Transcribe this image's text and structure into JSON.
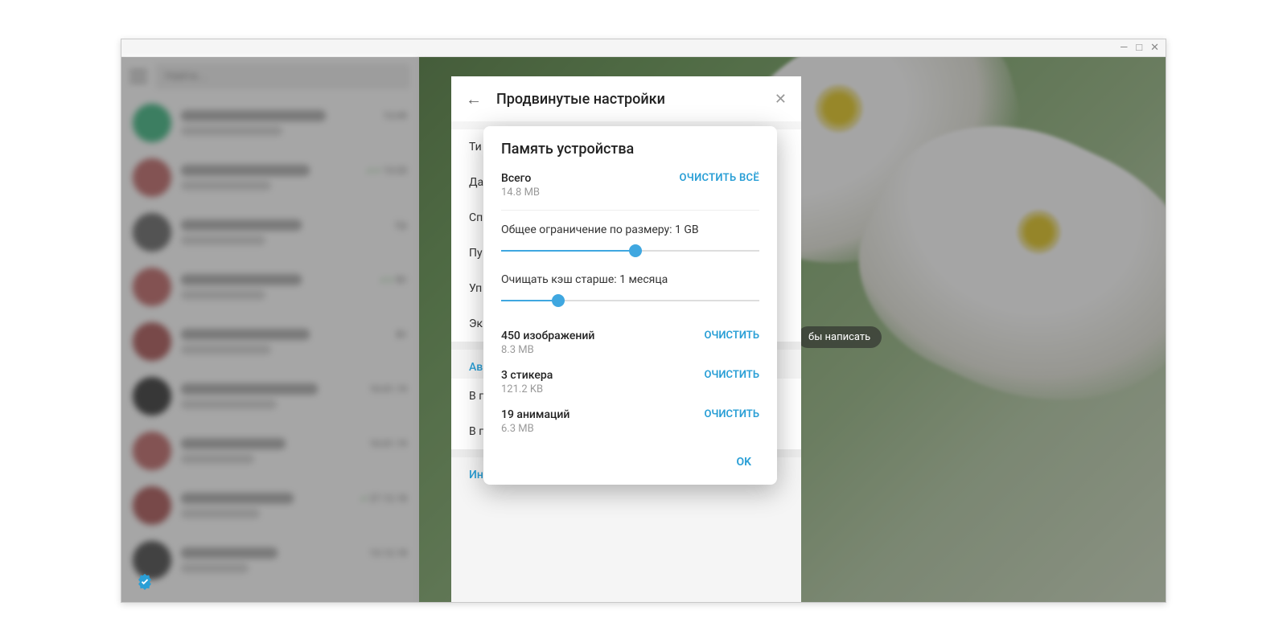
{
  "window_controls": {
    "min": "—",
    "max": "□",
    "close": "✕"
  },
  "sidebar": {
    "search_placeholder": "Найти...",
    "chats": [
      {
        "avatar_color": "#5cc295",
        "name_w": 180,
        "time": "13:49",
        "checks": ""
      },
      {
        "avatar_color": "#c98080",
        "name_w": 160,
        "time": "13:20",
        "checks": "✓✓"
      },
      {
        "avatar_color": "#808080",
        "name_w": 150,
        "time": "Ср",
        "checks": ""
      },
      {
        "avatar_color": "#c97f7f",
        "name_w": 150,
        "time": "Вт",
        "checks": "✓✓"
      },
      {
        "avatar_color": "#b87070",
        "name_w": 160,
        "time": "Вт",
        "checks": ""
      },
      {
        "avatar_color": "#555",
        "name_w": 170,
        "time": "10.01.19",
        "checks": ""
      },
      {
        "avatar_color": "#c98080",
        "name_w": 130,
        "time": "10.01.19",
        "checks": ""
      },
      {
        "avatar_color": "#b87070",
        "name_w": 140,
        "time": "27.12.18",
        "checks": "✓"
      },
      {
        "avatar_color": "#666",
        "name_w": 120,
        "time": "13.12.18",
        "checks": ""
      }
    ]
  },
  "write_hint": "бы написать",
  "advanced": {
    "title": "Продвинутые настройки",
    "rows_top": [
      "Ти",
      "Да",
      "Сп",
      "Пу",
      "Уп",
      "Эк"
    ],
    "section_auto": "Ав",
    "rows_auto": [
      "В п",
      "В п"
    ],
    "integration": "Интеграция в систему"
  },
  "popup": {
    "title": "Память устройства",
    "total_label": "Всего",
    "total_size": "14.8 MB",
    "clear_all": "ОЧИСТИТЬ ВСЁ",
    "size_limit_label": "Общее ограничение по размеру: 1 GB",
    "size_slider_pct": 52,
    "age_limit_label": "Очищать кэш старше: 1 месяца",
    "age_slider_pct": 22,
    "items": [
      {
        "title": "450 изображений",
        "size": "8.3 MB",
        "action": "ОЧИСТИТЬ"
      },
      {
        "title": "3 стикера",
        "size": "121.2 KB",
        "action": "ОЧИСТИТЬ"
      },
      {
        "title": "19 анимаций",
        "size": "6.3 MB",
        "action": "ОЧИСТИТЬ"
      }
    ],
    "ok": "OK"
  }
}
